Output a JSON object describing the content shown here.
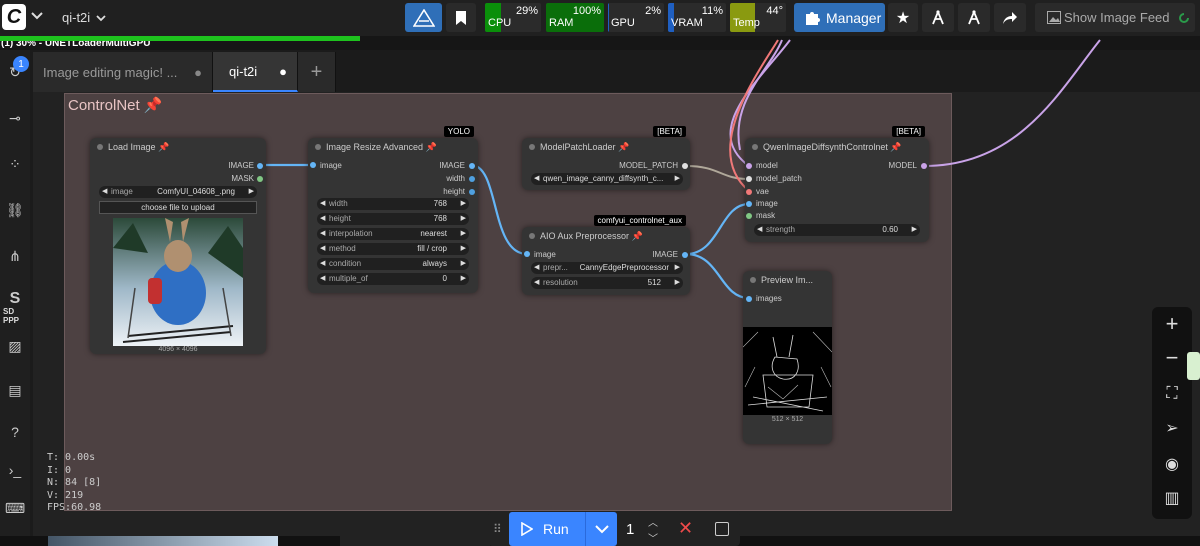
{
  "topbar": {
    "workflow_name": "qi-t2i",
    "manager_label": "Manager",
    "image_feed_label": "Show Image Feed",
    "meters": [
      {
        "label": "CPU",
        "value": "29%",
        "percent": 29,
        "color": "#0a8f0a"
      },
      {
        "label": "RAM",
        "value": "100%",
        "percent": 100,
        "color": "#0a6e0a"
      },
      {
        "label": "GPU",
        "value": "2%",
        "percent": 2,
        "color": "#1f5fc1"
      },
      {
        "label": "VRAM",
        "value": "11%",
        "percent": 11,
        "color": "#1f5fc1"
      },
      {
        "label": "Temp",
        "value": "44°",
        "percent": 44,
        "color": "#8a9a10"
      }
    ],
    "accent_color": "#2f6fb8"
  },
  "progress": {
    "text": "(1) 30% - UNETLoaderMultiGPU",
    "percent": 30
  },
  "sidebar": {
    "badge": "1",
    "sd_label": "SD PPP"
  },
  "tabs": [
    {
      "label": "Image editing magic! ...",
      "active": false
    },
    {
      "label": "qi-t2i",
      "active": true
    }
  ],
  "group": {
    "title": "ControlNet"
  },
  "nodes": {
    "load_image": {
      "title": "Load Image",
      "outputs": [
        "IMAGE",
        "MASK"
      ],
      "widget_label": "image",
      "widget_value": "ComfyUI_04608_.png",
      "upload_label": "choose file to upload",
      "size_label": "4096 × 4096"
    },
    "resize": {
      "title": "Image Resize Advanced",
      "badge": "YOLO",
      "input": "image",
      "outputs": [
        "IMAGE",
        "width",
        "height"
      ],
      "widgets": [
        {
          "label": "width",
          "value": "768"
        },
        {
          "label": "height",
          "value": "768"
        },
        {
          "label": "interpolation",
          "value": "nearest"
        },
        {
          "label": "method",
          "value": "fill / crop"
        },
        {
          "label": "condition",
          "value": "always"
        },
        {
          "label": "multiple_of",
          "value": "0"
        }
      ]
    },
    "patch_loader": {
      "title": "ModelPatchLoader",
      "badge": "[BETA]",
      "output": "MODEL_PATCH",
      "widget_value": "qwen_image_canny_diffsynth_c..."
    },
    "aio": {
      "title": "AIO Aux Preprocessor",
      "badge": "comfyui_controlnet_aux",
      "input": "image",
      "output": "IMAGE",
      "widgets": [
        {
          "label": "prepr...",
          "value": "CannyEdgePreprocessor"
        },
        {
          "label": "resolution",
          "value": "512"
        }
      ]
    },
    "diffsynth": {
      "title": "QwenImageDiffsynthControlnet",
      "badge": "[BETA]",
      "inputs": [
        "model",
        "model_patch",
        "vae",
        "image",
        "mask"
      ],
      "output": "MODEL",
      "widget": {
        "label": "strength",
        "value": "0.60"
      }
    },
    "preview": {
      "title": "Preview Im...",
      "input": "images",
      "size_label": "512 × 512"
    }
  },
  "stats": [
    "T: 0.00s",
    "I: 0",
    "N: 84 [8]",
    "V: 219",
    "FPS:60.98"
  ],
  "run_bar": {
    "run_label": "Run",
    "count": "1"
  }
}
